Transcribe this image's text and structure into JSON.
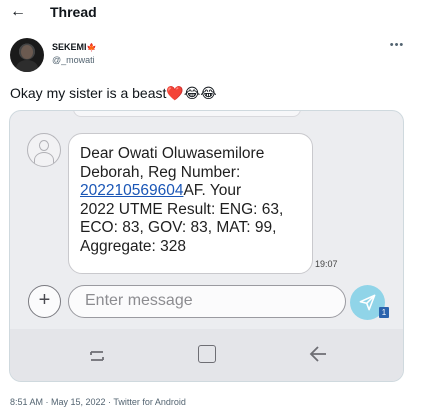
{
  "header": {
    "back_icon": "arrow-left-icon",
    "title": "Thread"
  },
  "tweet": {
    "author": {
      "display_name": "SEKEMI",
      "flag": "🍁",
      "handle": "@_mowati"
    },
    "more_icon": "more-horizontal-icon",
    "text": "Okay my sister is a beast",
    "emojis": {
      "heart": "❤️",
      "joy_1": "😂",
      "joy_2": "😂"
    },
    "footer": "8:51 AM · May 15, 2022 · Twitter for Android"
  },
  "sms": {
    "lines": [
      "Dear Owati Oluwasemilore",
      "Deborah, Reg Number:",
      "AF. Your",
      "2022 UTME Result: ENG: 63,",
      "ECO: 83, GOV: 83, MAT: 99,",
      "Aggregate: 328"
    ],
    "reg_number_link": "202210569604",
    "time": "19:07",
    "input_placeholder": "Enter message",
    "attach_label": "+",
    "sim_badge": "1",
    "colors": {
      "link": "#1a56b6",
      "send_button": "#90d4e8",
      "sim_badge": "#2b63ad"
    }
  },
  "icons": {
    "contact": "contact-avatar-icon",
    "send": "send-icon",
    "nav_recents": "recents-icon",
    "nav_home": "home-icon",
    "nav_back": "back-chevron-icon"
  }
}
